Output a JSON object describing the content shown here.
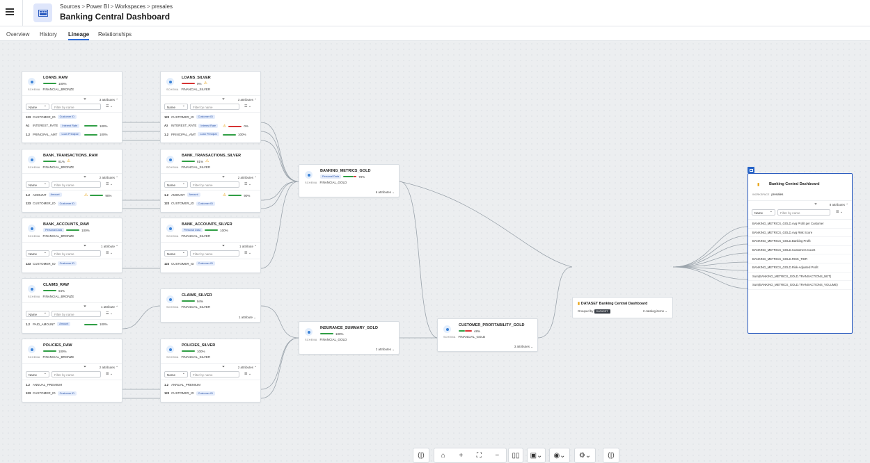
{
  "header": {
    "breadcrumbs": [
      "Sources",
      "Power BI",
      "Workspaces",
      "presales"
    ],
    "title": "Banking Central Dashboard"
  },
  "tabs": [
    "Overview",
    "History",
    "Lineage",
    "Relationships"
  ],
  "active_tab": "Lineage",
  "labels": {
    "schema": "SCHEMA",
    "workspace": "WORKSPACE",
    "select_name": "Name",
    "filter_placeholder": "Filter by name",
    "grouped_by": "Grouped by",
    "dataset_tag": "DATASET"
  },
  "nodes": {
    "loans_raw": {
      "name": "LOANS_RAW",
      "quality": "100%",
      "schema": "FINANCIAL_BRONZE",
      "attr_count": "3 attributes",
      "fields": [
        {
          "type": "123",
          "name": "CUSTOMER_ID",
          "tag": "Customer ID"
        },
        {
          "type": "Az",
          "name": "INTEREST_RATE",
          "tag": "Interest Rate",
          "quality": "100%"
        },
        {
          "type": "1.2",
          "name": "PRINCIPAL_AMT",
          "tag": "Loan Principal",
          "quality": "100%"
        }
      ]
    },
    "loans_silver": {
      "name": "LOANS_SILVER",
      "quality": "0%",
      "schema": "FINANCIAL_SILVER",
      "attr_count": "3 attributes",
      "fields": [
        {
          "type": "123",
          "name": "CUSTOMER_ID",
          "tag": "Customer ID"
        },
        {
          "type": "Az",
          "name": "INTEREST_RATE",
          "tag": "Interest Rate",
          "quality": "0%"
        },
        {
          "type": "1.2",
          "name": "PRINCIPAL_AMT",
          "tag": "Loan Principal",
          "quality": "100%"
        }
      ]
    },
    "bank_transactions_raw": {
      "name": "BANK_TRANSACTIONS_RAW",
      "quality": "81%",
      "schema": "FINANCIAL_BRONZE",
      "attr_count": "2 attributes",
      "fields": [
        {
          "type": "1.2",
          "name": "AMOUNT",
          "tag": "Amount",
          "quality": "90%"
        },
        {
          "type": "123",
          "name": "CUSTOMER_ID",
          "tag": "Customer ID"
        }
      ]
    },
    "bank_transactions_silver": {
      "name": "BANK_TRANSACTIONS_SILVER",
      "quality": "81%",
      "schema": "FINANCIAL_SILVER",
      "attr_count": "2 attributes",
      "fields": [
        {
          "type": "1.2",
          "name": "AMOUNT",
          "tag": "Amount",
          "quality": "90%"
        },
        {
          "type": "123",
          "name": "CUSTOMER_ID",
          "tag": "Customer ID"
        }
      ]
    },
    "bank_accounts_raw": {
      "name": "BANK_ACCOUNTS_RAW",
      "tag": "Personal Data",
      "quality": "100%",
      "schema": "FINANCIAL_BRONZE",
      "attr_count": "1 attribute",
      "fields": [
        {
          "type": "123",
          "name": "CUSTOMER_ID",
          "tag": "Customer ID"
        }
      ]
    },
    "bank_accounts_silver": {
      "name": "BANK_ACCOUNTS_SILVER",
      "tag": "Personal Data",
      "quality": "100%",
      "schema": "FINANCIAL_SILVER",
      "attr_count": "1 attribute",
      "fields": [
        {
          "type": "123",
          "name": "CUSTOMER_ID",
          "tag": "Customer ID"
        }
      ]
    },
    "claims_raw": {
      "name": "CLAIMS_RAW",
      "quality": "94%",
      "schema": "FINANCIAL_BRONZE",
      "attr_count": "1 attribute",
      "fields": [
        {
          "type": "1.2",
          "name": "PAID_AMOUNT",
          "tag": "Amount",
          "quality": "100%"
        }
      ]
    },
    "claims_silver": {
      "name": "CLAIMS_SILVER",
      "quality": "94%",
      "schema": "FINANCIAL_SILVER",
      "footer": "1 attribute"
    },
    "policies_raw": {
      "name": "POLICIES_RAW",
      "quality": "100%",
      "schema": "FINANCIAL_BRONZE",
      "attr_count": "2 attributes",
      "fields": [
        {
          "type": "1.2",
          "name": "ANNUAL_PREMIUM"
        },
        {
          "type": "123",
          "name": "CUSTOMER_ID",
          "tag": "Customer ID"
        }
      ]
    },
    "policies_silver": {
      "name": "POLICIES_SILVER",
      "quality": "100%",
      "schema": "FINANCIAL_SILVER",
      "attr_count": "2 attributes",
      "fields": [
        {
          "type": "1.2",
          "name": "ANNUAL_PREMIUM"
        },
        {
          "type": "123",
          "name": "CUSTOMER_ID",
          "tag": "Customer ID"
        }
      ]
    },
    "banking_metrics_gold": {
      "name": "BANKING_METRICS_GOLD",
      "tag": "Personal Data",
      "quality": "79%",
      "schema": "FINANCIAL_GOLD",
      "footer": "6 attributes"
    },
    "insurance_summary_gold": {
      "name": "INSURANCE_SUMMARY_GOLD",
      "quality": "100%",
      "schema": "FINANCIAL_GOLD",
      "footer": "2 attributes"
    },
    "customer_profitability_gold": {
      "name": "CUSTOMER_PROFITABILITY_GOLD",
      "quality": "48%",
      "schema": "FINANCIAL_GOLD",
      "footer": "3 attributes"
    }
  },
  "dataset": {
    "title": "DATASET Banking Central Dashboard",
    "items": "2 catalog items"
  },
  "dashboard": {
    "title": "Banking Central Dashboard",
    "workspace": "presales",
    "attr_count": "8 attributes",
    "fields": [
      "BANKING_METRICS_GOLD.Avg Profit per Customer",
      "BANKING_METRICS_GOLD.Avg Risk Score",
      "BANKING_METRICS_GOLD.Banking Profit",
      "BANKING_METRICS_GOLD.Customers Count",
      "BANKING_METRICS_GOLD.RISK_TIER",
      "BANKING_METRICS_GOLD.Risk-Adjusted Profit",
      "Sum(BANKING_METRICS_GOLD.TRANSACTIONS_NET)",
      "Sum(BANKING_METRICS_GOLD.TRANSACTIONS_VOLUME)"
    ]
  },
  "toolbar": [
    {
      "icon": "fit-horizontal-icon"
    },
    {
      "icon": "home-icon"
    },
    {
      "icon": "zoom-in-icon"
    },
    {
      "icon": "fit-view-icon"
    },
    {
      "icon": "zoom-out-icon"
    },
    {
      "icon": "columns-icon"
    },
    {
      "icon": "layout-icon"
    },
    {
      "icon": "eye-icon"
    },
    {
      "icon": "settings-icon"
    },
    {
      "icon": "expand-icon"
    }
  ]
}
